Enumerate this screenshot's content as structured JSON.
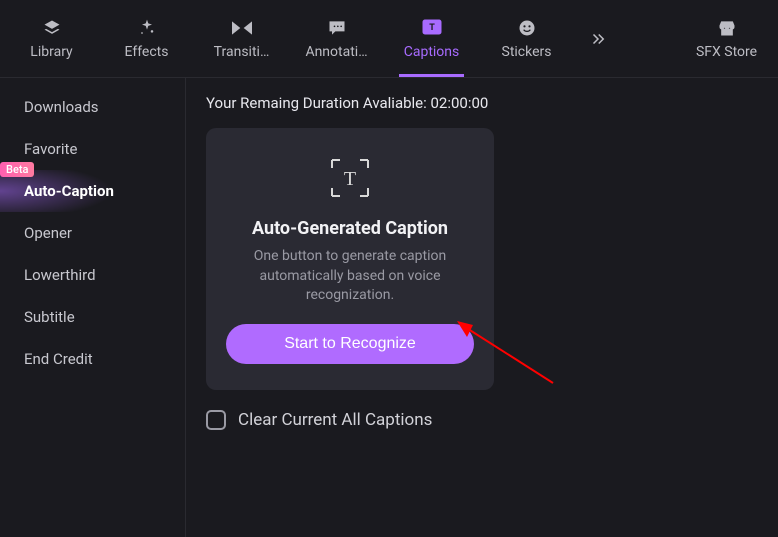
{
  "tabs": {
    "library": "Library",
    "effects": "Effects",
    "transitions": "Transiti…",
    "annotations": "Annotati…",
    "captions": "Captions",
    "stickers": "Stickers",
    "sfx": "SFX Store"
  },
  "sidebar": {
    "items": [
      {
        "label": "Downloads"
      },
      {
        "label": "Favorite"
      },
      {
        "label": "Auto-Caption",
        "badge": "Beta"
      },
      {
        "label": "Opener"
      },
      {
        "label": "Lowerthird"
      },
      {
        "label": "Subtitle"
      },
      {
        "label": "End Credit"
      }
    ]
  },
  "main": {
    "duration_prefix": "Your Remaing Duration Avaliable: ",
    "duration_value": "02:00:00",
    "card": {
      "title": "Auto-Generated Caption",
      "desc": "One button to generate caption automatically based on voice recognization.",
      "button": "Start to Recognize"
    },
    "clear_label": "Clear Current All Captions"
  },
  "colors": {
    "accent": "#a86bff",
    "button": "#b06bff"
  }
}
